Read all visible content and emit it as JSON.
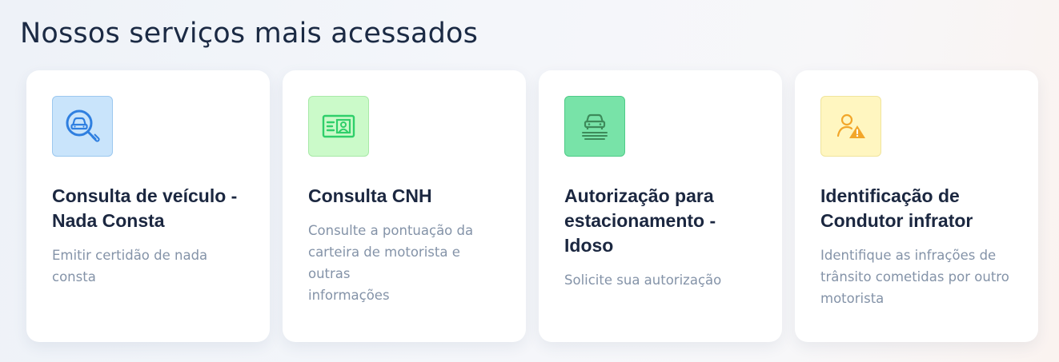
{
  "section": {
    "title": "Nossos serviços mais acessados"
  },
  "cards": [
    {
      "icon": "vehicle-search-icon",
      "title_lines": [
        "Consulta de veículo -",
        "Nada Consta"
      ],
      "desc_lines": [
        "Emitir certidão de nada",
        "consta"
      ]
    },
    {
      "icon": "id-card-icon",
      "title_lines": [
        "Consulta CNH"
      ],
      "desc_lines": [
        "Consulte a pontuação da",
        "carteira de motorista e outras",
        "informações"
      ]
    },
    {
      "icon": "parking-car-icon",
      "title_lines": [
        "Autorização para",
        "estacionamento -",
        "Idoso"
      ],
      "desc_lines": [
        "Solicite sua autorização"
      ]
    },
    {
      "icon": "driver-warning-icon",
      "title_lines": [
        "Identificação de",
        "Condutor infrator"
      ],
      "desc_lines": [
        "Identifique as infrações de",
        "trânsito cometidas por outro",
        "motorista"
      ]
    }
  ],
  "colors": {
    "title": "#1b2a44",
    "card_title": "#1b2740",
    "card_desc": "#8493a8",
    "icon_blue": "#2f7fe0",
    "icon_green": "#2fcf6a",
    "icon_darkgreen": "#3d8a5a",
    "icon_orange": "#f2a62a"
  }
}
